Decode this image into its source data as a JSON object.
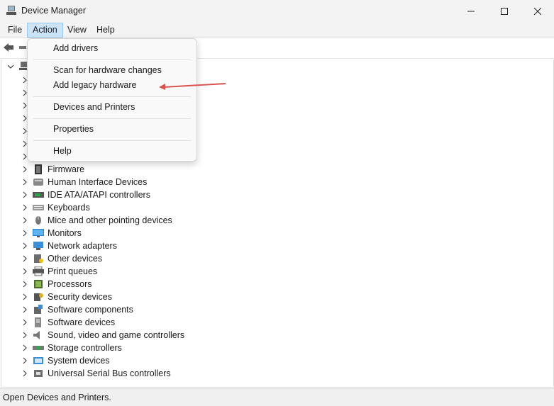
{
  "window": {
    "title": "Device Manager",
    "controls": {
      "minimize": "—",
      "maximize": "☐",
      "close": "✕"
    }
  },
  "menubar": [
    {
      "label": "File"
    },
    {
      "label": "Action",
      "active": true
    },
    {
      "label": "View"
    },
    {
      "label": "Help"
    }
  ],
  "action_menu": {
    "items": [
      {
        "label": "Add drivers"
      },
      {
        "label": "Scan for hardware changes"
      },
      {
        "label": "Add legacy hardware",
        "annotated": true
      },
      {
        "label": "Devices and Printers"
      },
      {
        "label": "Properties"
      },
      {
        "label": "Help"
      }
    ],
    "annotation": {
      "type": "red-arrow",
      "color": "#d9534f"
    }
  },
  "tree": {
    "categories": [
      {
        "label": "Firmware",
        "icon": "firmware-icon"
      },
      {
        "label": "Human Interface Devices",
        "icon": "hid-icon"
      },
      {
        "label": "IDE ATA/ATAPI controllers",
        "icon": "ide-controller-icon"
      },
      {
        "label": "Keyboards",
        "icon": "keyboard-icon"
      },
      {
        "label": "Mice and other pointing devices",
        "icon": "mouse-icon"
      },
      {
        "label": "Monitors",
        "icon": "monitor-icon"
      },
      {
        "label": "Network adapters",
        "icon": "network-adapter-icon"
      },
      {
        "label": "Other devices",
        "icon": "other-devices-icon"
      },
      {
        "label": "Print queues",
        "icon": "printer-icon"
      },
      {
        "label": "Processors",
        "icon": "processor-icon"
      },
      {
        "label": "Security devices",
        "icon": "security-device-icon"
      },
      {
        "label": "Software components",
        "icon": "software-component-icon"
      },
      {
        "label": "Software devices",
        "icon": "software-device-icon"
      },
      {
        "label": "Sound, video and game controllers",
        "icon": "speaker-icon"
      },
      {
        "label": "Storage controllers",
        "icon": "storage-controller-icon"
      },
      {
        "label": "System devices",
        "icon": "system-device-icon"
      },
      {
        "label": "Universal Serial Bus controllers",
        "icon": "usb-icon"
      }
    ]
  },
  "statusbar": {
    "text": "Open Devices and Printers."
  },
  "colors": {
    "menu_highlight": "#cce4f7",
    "arrow": "#d9534f"
  }
}
